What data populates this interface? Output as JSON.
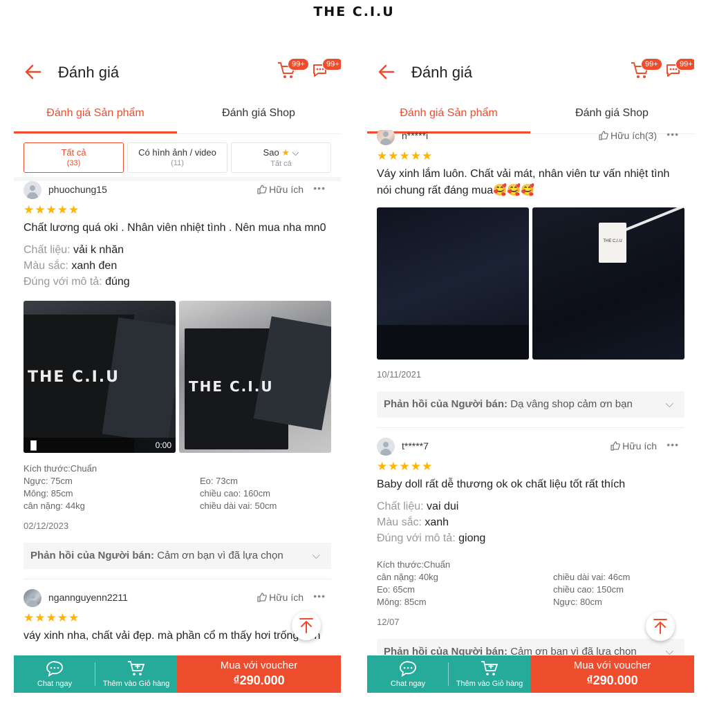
{
  "brand": "THE C.I.U",
  "colors": {
    "accent": "#ee4d2d",
    "teal": "#26aa99",
    "star": "#ffb400"
  },
  "left": {
    "header": {
      "title": "Đánh giá",
      "cart_badge": "99+",
      "chat_badge": "99+"
    },
    "tabs": [
      "Đánh giá Sản phẩm",
      "Đánh giá Shop"
    ],
    "filters": [
      {
        "label": "Tất cả",
        "sub": "(33)"
      },
      {
        "label": "Có hình ảnh / video",
        "sub": "(11)"
      },
      {
        "label": "Sao",
        "sub": "Tất cả"
      }
    ],
    "reviews": [
      {
        "user": "phuochung15",
        "helpful": "Hữu ích",
        "stars": "★★★★★",
        "content": "Chất lương quá oki . Nhân viên nhiệt tình . Nên mua nha mn0",
        "attrs": [
          {
            "k": "Chất liệu:",
            "v": "vải k nhăn"
          },
          {
            "k": "Màu sắc:",
            "v": "xanh đen"
          },
          {
            "k": "Đúng với mô tả:",
            "v": "đúng"
          }
        ],
        "video_time": "0:00",
        "measure": [
          "Kích thước:Chuẩn",
          "",
          "Ngực: 75cm",
          "Eo: 73cm",
          "Mông: 85cm",
          "chiều cao: 160cm",
          "cân nặng: 44kg",
          "chiều dài vai: 50cm"
        ],
        "date": "02/12/2023",
        "seller_label": "Phản hồi của Người bán:",
        "seller_text": "Cảm ơn bạn vì đã lựa chọn"
      },
      {
        "user": "ngannguyenn2211",
        "helpful": "Hữu ích",
        "stars": "★★★★★",
        "content": "váy xinh nha, chất vải đẹp. mà phần cổ m thấy hơi trống nên"
      }
    ],
    "bottom": {
      "chat": "Chat ngay",
      "cart": "Thêm vào Giỏ hàng",
      "buy": "Mua với voucher",
      "price": "₫290.000"
    }
  },
  "right": {
    "header": {
      "title": "Đánh giá",
      "cart_badge": "99+",
      "chat_badge": "99+"
    },
    "tabs": [
      "Đánh giá Sản phẩm",
      "Đánh giá Shop"
    ],
    "reviews": [
      {
        "user": "n*****i",
        "helpful": "Hữu ích(3)",
        "stars": "★★★★★",
        "content": "Váy xinh lắm luôn. Chất vải mát, nhân viên tư vấn nhiệt tình nói chung rất đáng mua🥰🥰🥰",
        "tag_text": "THE C.I.U",
        "date": "10/11/2021",
        "seller_label": "Phản hồi của Người bán:",
        "seller_text": "Dạ vâng shop cảm ơn bạn"
      },
      {
        "user": "t*****7",
        "helpful": "Hữu ích",
        "stars": "★★★★★",
        "content": "Baby doll rất dễ thương ok ok chất liệu tốt rất thích",
        "attrs": [
          {
            "k": "Chất liệu:",
            "v": "vai dui"
          },
          {
            "k": "Màu sắc:",
            "v": "xanh"
          },
          {
            "k": "Đúng với mô tả:",
            "v": "giong"
          }
        ],
        "measure": [
          "Kích thước:Chuẩn",
          "",
          "cân nặng: 40kg",
          "chiều dài vai: 46cm",
          "Eo: 65cm",
          "chiều cao: 150cm",
          "Mông: 85cm",
          "Ngực: 80cm"
        ],
        "date": "12/07",
        "seller_label": "Phản hồi của Người bán:",
        "seller_text": "Cảm ơn bạn vì đã lựa chọn"
      }
    ],
    "bottom": {
      "chat": "Chat ngay",
      "cart": "Thêm vào Giỏ hàng",
      "buy": "Mua với voucher",
      "price": "₫290.000"
    }
  }
}
